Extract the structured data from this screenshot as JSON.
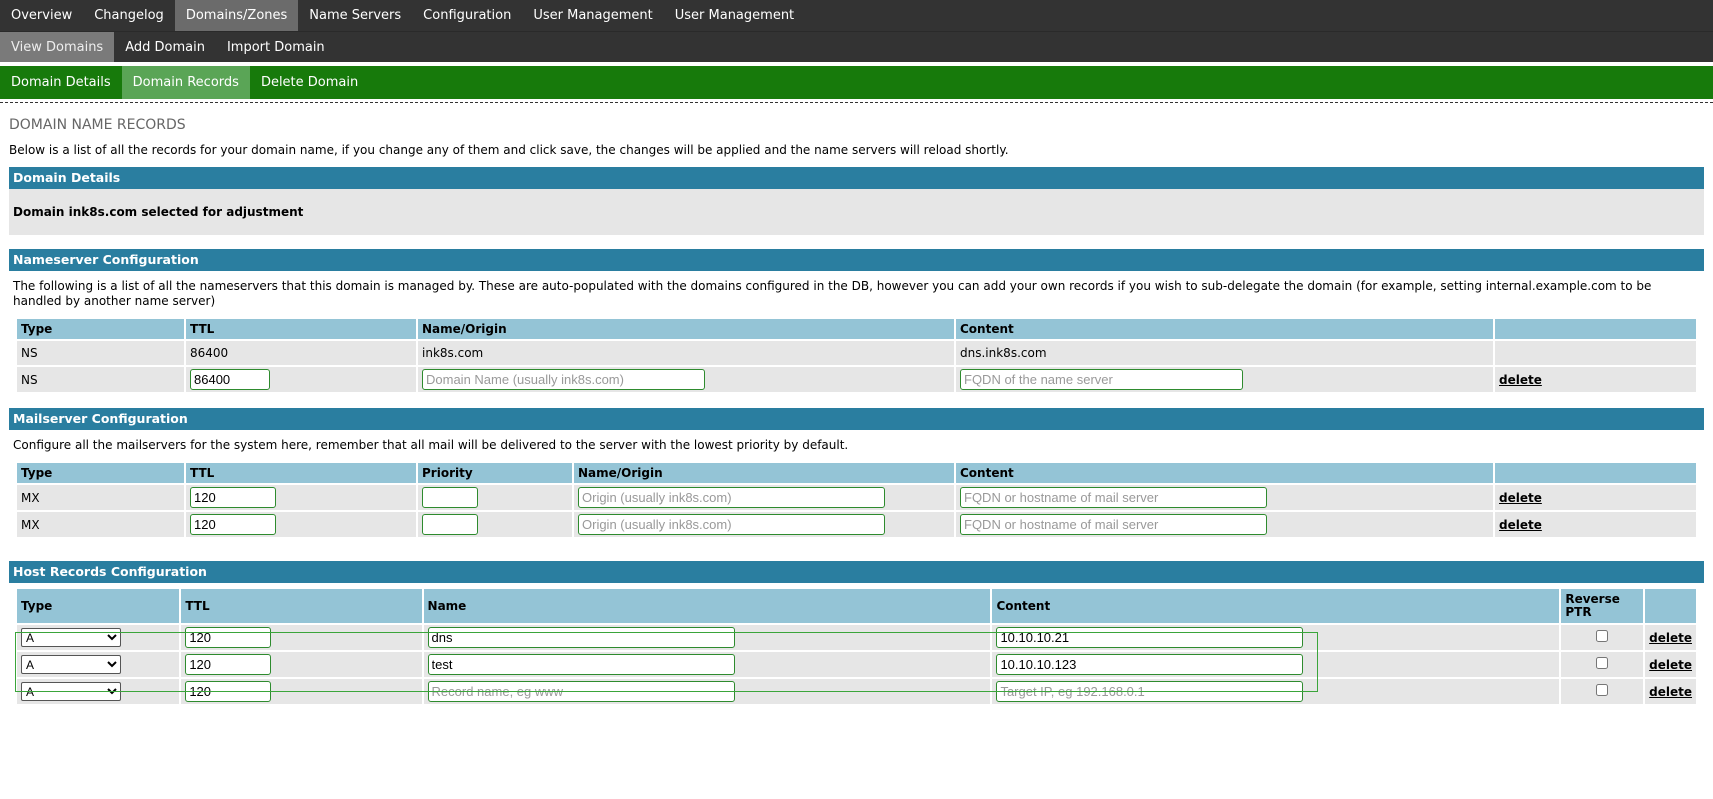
{
  "nav_top": [
    "Overview",
    "Changelog",
    "Domains/Zones",
    "Name Servers",
    "Configuration",
    "User Management",
    "User Management"
  ],
  "nav_sub": [
    "View Domains",
    "Add Domain",
    "Import Domain"
  ],
  "nav_domain": [
    "Domain Details",
    "Domain Records",
    "Delete Domain"
  ],
  "page_title": "DOMAIN NAME RECORDS",
  "intro": "Below is a list of all the records for your domain name, if you change any of them and click save, the changes will be applied and the name servers will reload shortly.",
  "domain_details": {
    "title": "Domain Details",
    "text": "Domain ink8s.com selected for adjustment"
  },
  "nameserver": {
    "title": "Nameserver Configuration",
    "desc": "The following is a list of all the nameservers that this domain is managed by. These are auto-populated with the domains configured in the DB, however you can add your own records if you wish to sub-delegate the domain (for example, setting internal.example.com to be handled by another name server)",
    "headers": [
      "Type",
      "TTL",
      "Name/Origin",
      "Content"
    ],
    "row1": {
      "type": "NS",
      "ttl": "86400",
      "name": "ink8s.com",
      "content": "dns.ink8s.com"
    },
    "row2": {
      "type": "NS",
      "ttl": "86400",
      "name_ph": "Domain Name (usually ink8s.com)",
      "content_ph": "FQDN of the name server"
    }
  },
  "mailserver": {
    "title": "Mailserver Configuration",
    "desc": "Configure all the mailservers for the system here, remember that all mail will be delivered to the server with the lowest priority by default.",
    "headers": [
      "Type",
      "TTL",
      "Priority",
      "Name/Origin",
      "Content"
    ],
    "rows": [
      {
        "type": "MX",
        "ttl": "120",
        "name_ph": "Origin (usually ink8s.com)",
        "content_ph": "FQDN or hostname of mail server"
      },
      {
        "type": "MX",
        "ttl": "120",
        "name_ph": "Origin (usually ink8s.com)",
        "content_ph": "FQDN or hostname of mail server"
      }
    ]
  },
  "host": {
    "title": "Host Records Configuration",
    "headers": [
      "Type",
      "TTL",
      "Name",
      "Content",
      "Reverse PTR"
    ],
    "rows": [
      {
        "type": "A",
        "ttl": "120",
        "name": "dns",
        "content": "10.10.10.21"
      },
      {
        "type": "A",
        "ttl": "120",
        "name": "test",
        "content": "10.10.10.123"
      },
      {
        "type": "A",
        "ttl": "120",
        "name_ph": "Record name, eg www",
        "content_ph": "Target IP, eg 192.168.0.1"
      }
    ]
  },
  "delete_label": "delete",
  "colors": {
    "nav_dark": "#333333",
    "nav_green": "#177a0b",
    "section_blue": "#2a7ea0",
    "header_light_blue": "#94c4d6",
    "input_border_green": "#2e8b2e"
  }
}
